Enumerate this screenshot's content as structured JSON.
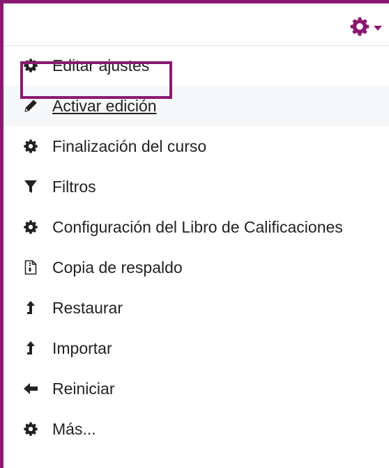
{
  "header": {
    "gear_icon": "gear-icon",
    "dropdown_icon": "caret-down-icon",
    "accent_color": "#8a1a6f"
  },
  "menu": {
    "items": [
      {
        "label": "Editar ajustes",
        "icon": "gear-icon"
      },
      {
        "label": "Activar edición",
        "icon": "pencil-icon"
      },
      {
        "label": "Finalización del curso",
        "icon": "gear-icon"
      },
      {
        "label": "Filtros",
        "icon": "filter-icon"
      },
      {
        "label": "Configuración del Libro de Calificaciones",
        "icon": "gear-icon"
      },
      {
        "label": "Copia de respaldo",
        "icon": "backup-file-icon"
      },
      {
        "label": "Restaurar",
        "icon": "arrow-up-icon"
      },
      {
        "label": "Importar",
        "icon": "arrow-up-icon"
      },
      {
        "label": "Reiniciar",
        "icon": "arrow-left-icon"
      },
      {
        "label": "Más...",
        "icon": "gear-icon"
      }
    ]
  }
}
